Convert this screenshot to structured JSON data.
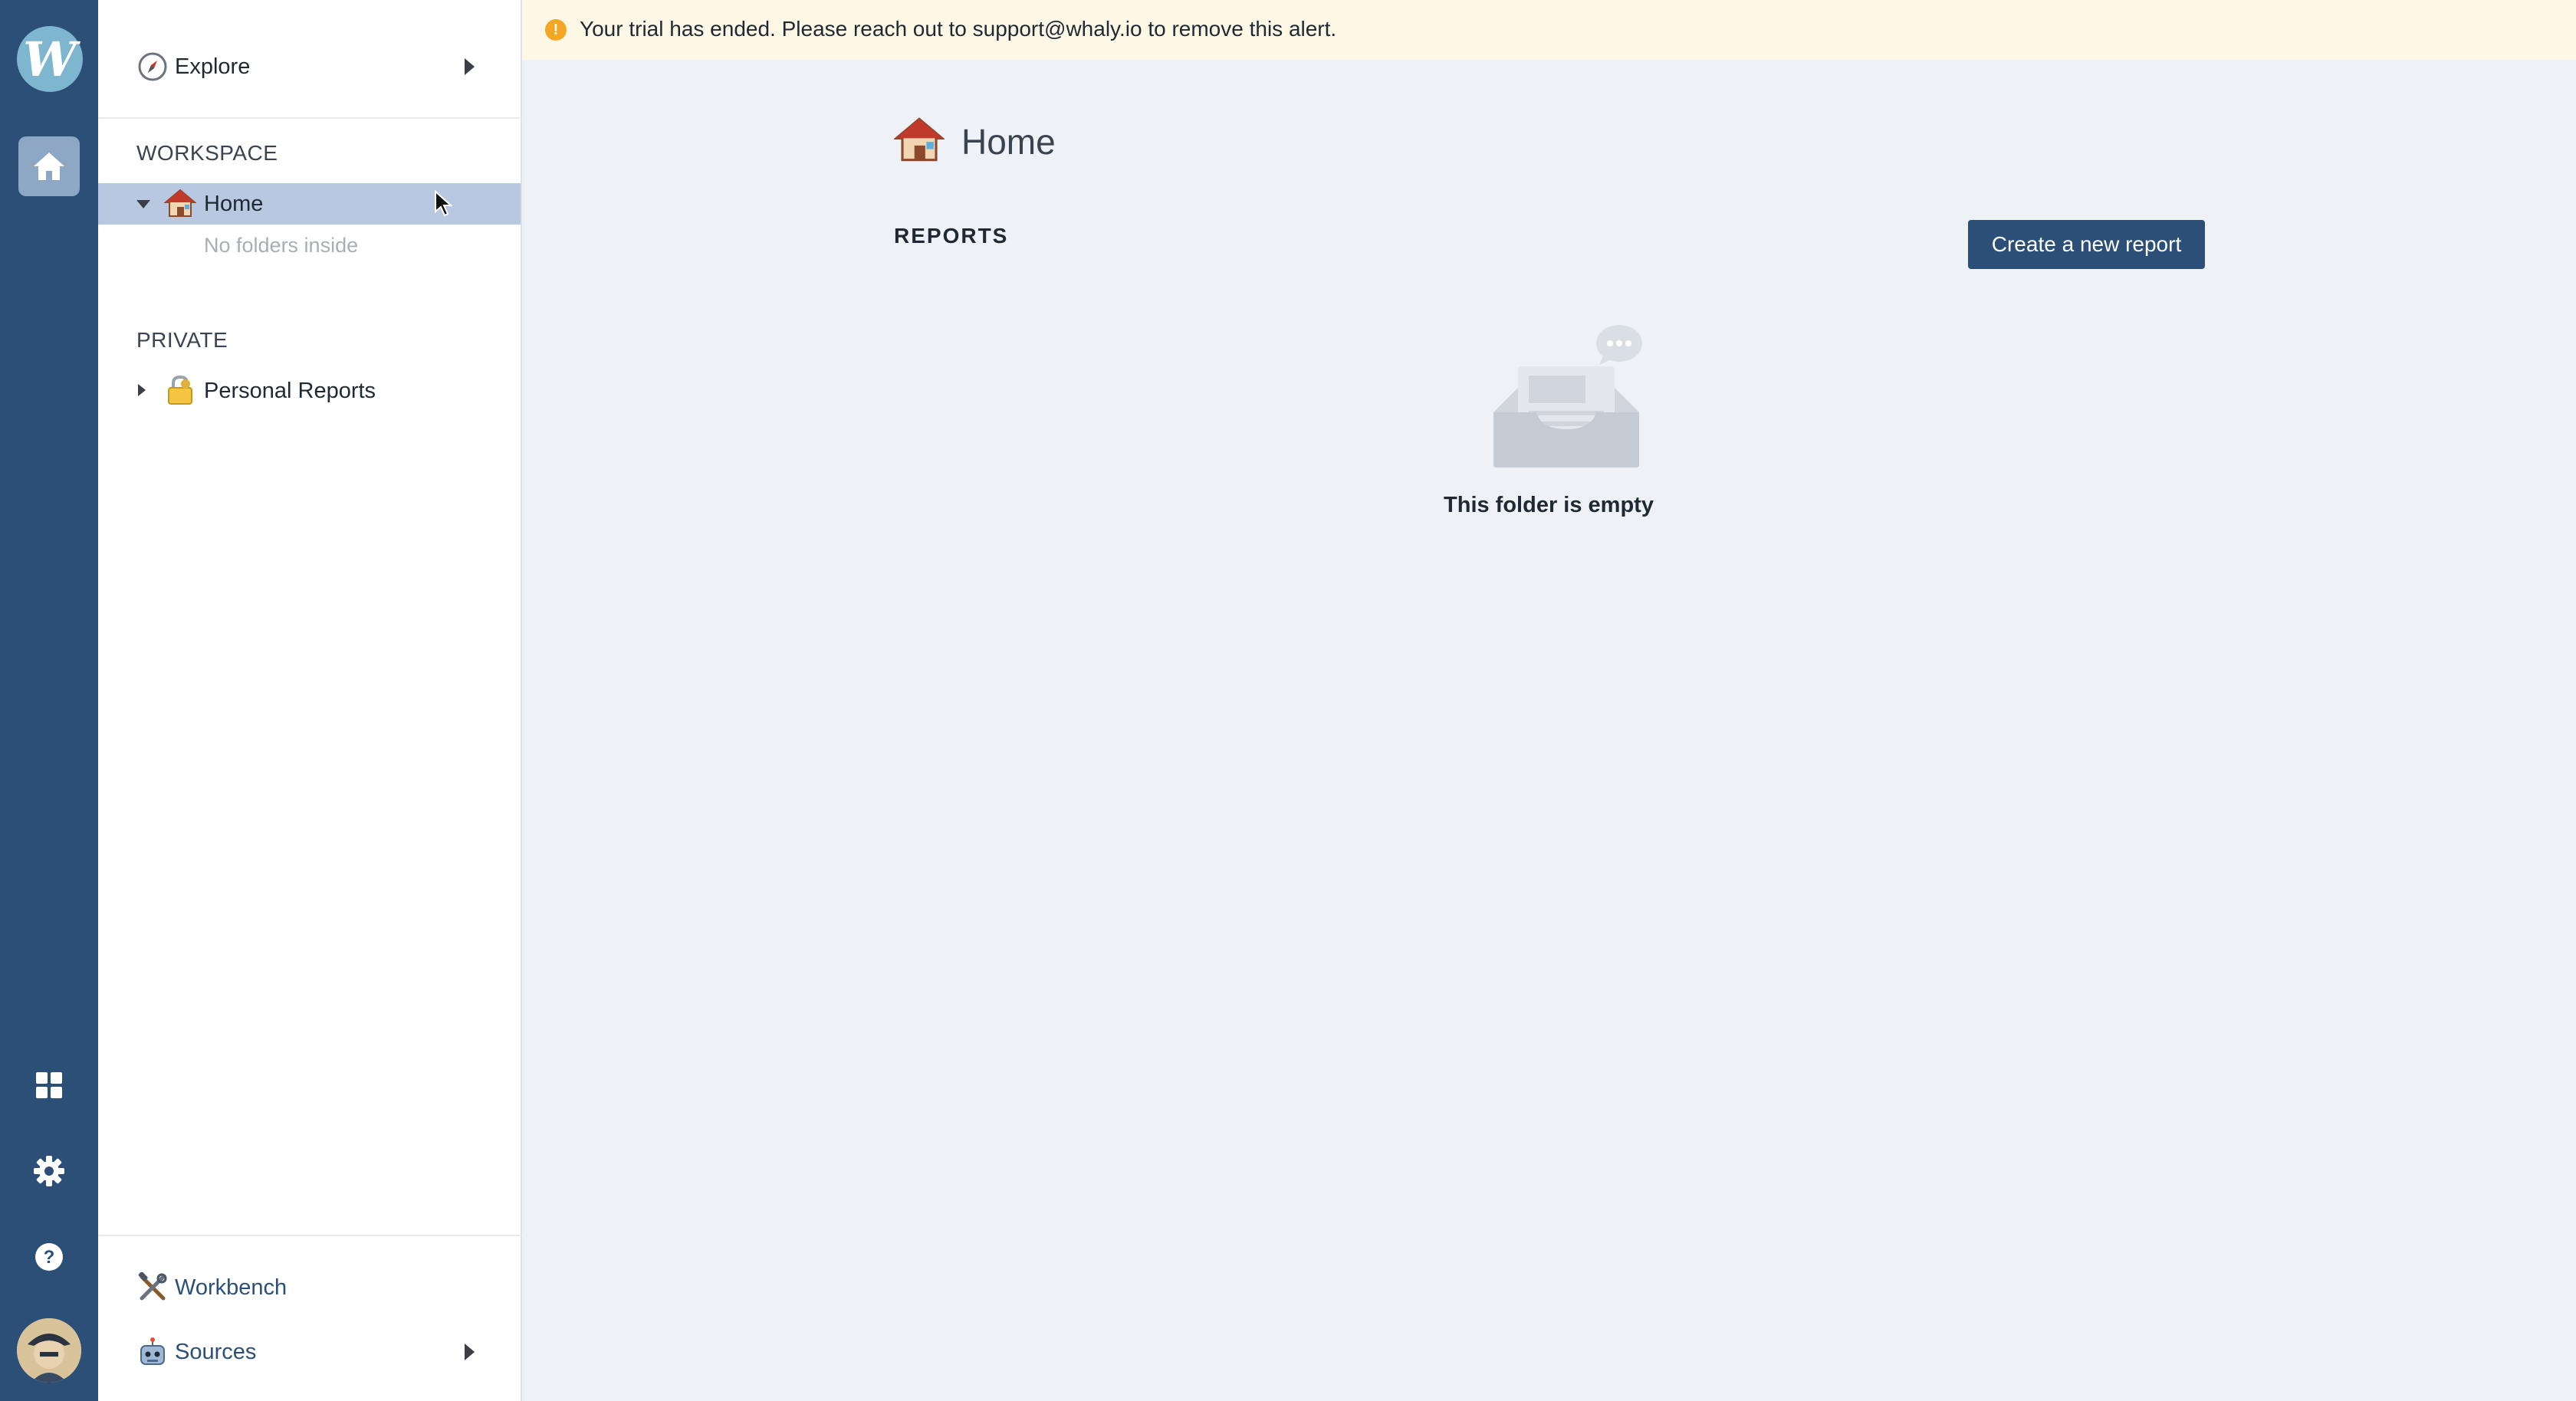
{
  "colors": {
    "rail": "#2c4f78",
    "accent": "#2c4f78",
    "selected_row": "#b7c8e0",
    "banner_bg": "#fdf8e6",
    "warning": "#f5a623",
    "page_bg": "#eef1f5"
  },
  "rail": {
    "logo_letter": "W",
    "icons": [
      "home-icon",
      "dashboard-grid-icon",
      "settings-gear-icon",
      "help-icon"
    ]
  },
  "sidebar": {
    "explore_label": "Explore",
    "workspace_title": "WORKSPACE",
    "home_label": "Home",
    "no_folders": "No folders inside",
    "private_title": "PRIVATE",
    "personal_reports_label": "Personal Reports",
    "workbench_label": "Workbench",
    "sources_label": "Sources"
  },
  "banner": {
    "icon": "!",
    "text": "Your trial has ended. Please reach out to support@whaly.io to remove this alert."
  },
  "main": {
    "title": "Home",
    "reports_heading": "REPORTS",
    "create_button": "Create a new report",
    "empty_text": "This folder is empty"
  }
}
